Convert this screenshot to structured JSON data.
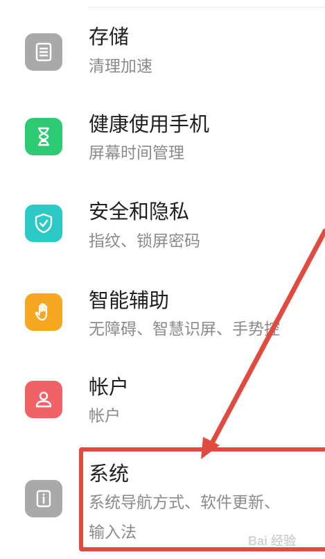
{
  "settings": {
    "items": [
      {
        "title": "存储",
        "subtitle": "清理加速",
        "icon": "storage-icon",
        "color": "#a9a9a9"
      },
      {
        "title": "健康使用手机",
        "subtitle": "屏幕时间管理",
        "icon": "hourglass-icon",
        "color": "#2ccb73"
      },
      {
        "title": "安全和隐私",
        "subtitle": "指纹、锁屏密码",
        "icon": "shield-check-icon",
        "color": "#2cc9c7"
      },
      {
        "title": "智能辅助",
        "subtitle": "无障碍、智慧识屏、手势控",
        "icon": "hand-icon",
        "color": "#f6a722"
      },
      {
        "title": "帐户",
        "subtitle": "帐户",
        "icon": "account-icon",
        "color": "#f06266"
      },
      {
        "title": "系统",
        "subtitle": "系统导航方式、软件更新、",
        "subtitle_line2": "输入法",
        "icon": "system-info-icon",
        "color": "#a9a9a9"
      }
    ]
  },
  "annotation": {
    "color": "#e14b3f"
  },
  "watermark": {
    "text": "Bai 经验"
  }
}
